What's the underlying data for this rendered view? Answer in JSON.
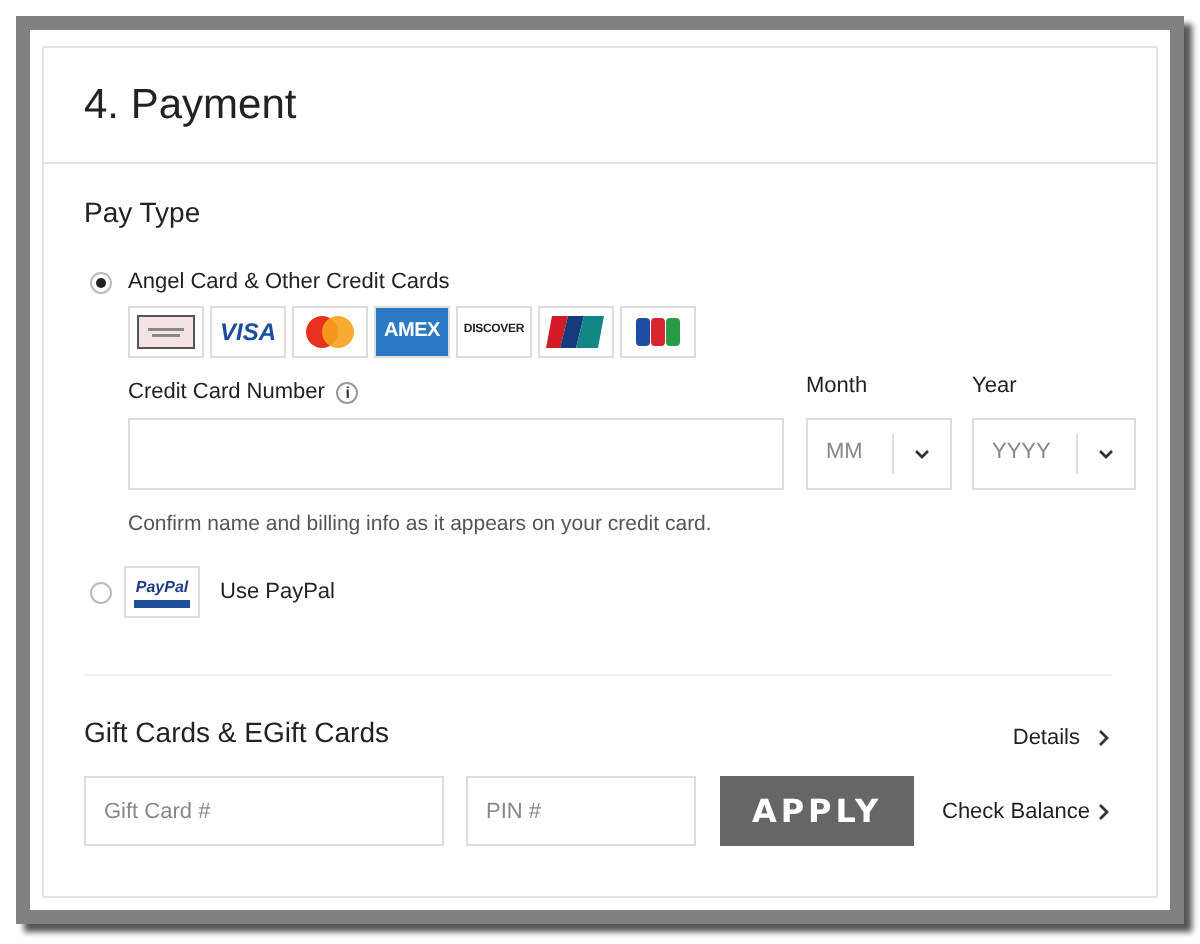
{
  "title": "4. Payment",
  "pay_type": {
    "heading": "Pay Type",
    "options": [
      {
        "kind": "cards",
        "label": "Angel Card & Other Credit Cards",
        "selected": true
      },
      {
        "kind": "paypal",
        "label": "Use PayPal",
        "logo_text": "PayPal",
        "selected": false
      }
    ],
    "cards": [
      {
        "kind": "angel"
      },
      {
        "kind": "visa",
        "label": "VISA"
      },
      {
        "kind": "mastercard"
      },
      {
        "kind": "amex",
        "label": "AMEX"
      },
      {
        "kind": "discover",
        "label": "DISCOVER"
      },
      {
        "kind": "unionpay"
      },
      {
        "kind": "jcb"
      }
    ],
    "card_number": {
      "label": "Credit Card Number",
      "info": "i"
    },
    "month": {
      "label": "Month",
      "placeholder": "MM"
    },
    "year": {
      "label": "Year",
      "placeholder": "YYYY"
    },
    "hint": "Confirm name and billing info as it appears on your credit card."
  },
  "gift_cards": {
    "heading": "Gift Cards & EGift Cards",
    "details_link": "Details",
    "gift_card": {
      "placeholder": "Gift Card #"
    },
    "pin": {
      "placeholder": "PIN #"
    },
    "apply_button": "APPLY",
    "check_balance_link": "Check Balance"
  }
}
